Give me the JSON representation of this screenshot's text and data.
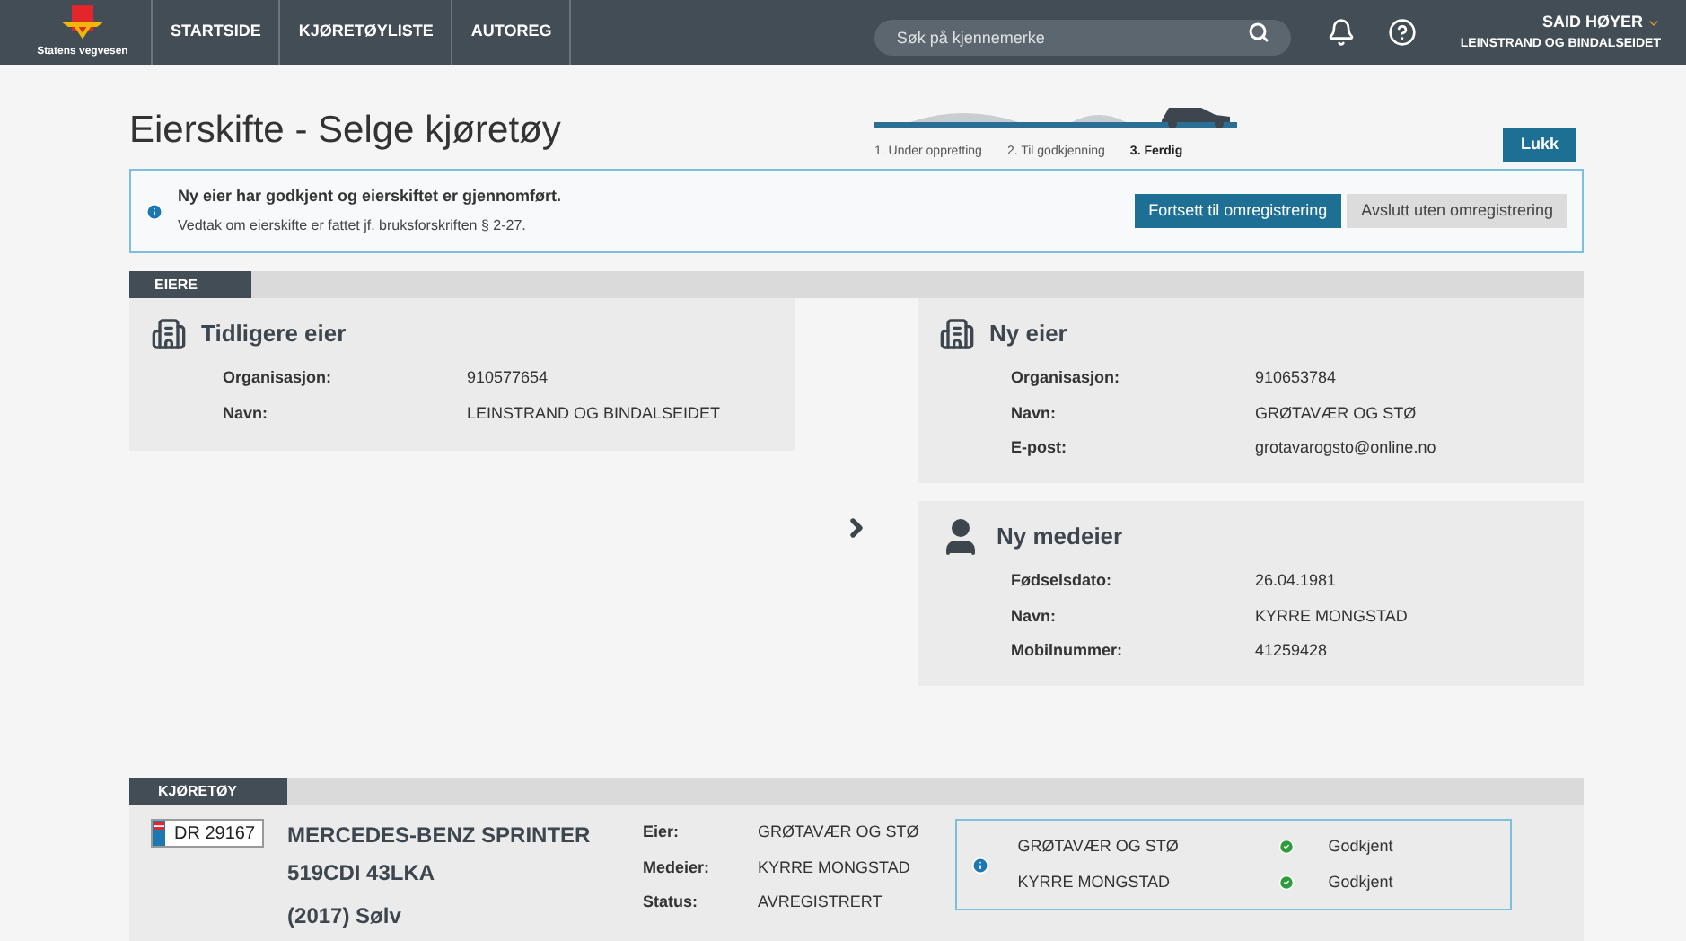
{
  "header": {
    "logo_text": "Statens vegvesen",
    "nav": [
      {
        "label": "STARTSIDE",
        "selected": false
      },
      {
        "label": "KJØRETØYLISTE",
        "selected": false
      },
      {
        "label": "AUTOREG",
        "selected": false
      }
    ],
    "search": {
      "placeholder": "Søk på kjennemerke"
    },
    "user": {
      "name": "SAID HØYER",
      "org": "LEINSTRAND OG BINDALSEIDET"
    }
  },
  "page": {
    "title": "Eierskifte - Selge kjøretøy",
    "close_button": "Lukk"
  },
  "steps": [
    {
      "label": "1. Under oppretting",
      "selected": false
    },
    {
      "label": "2. Til godkjenning",
      "selected": false
    },
    {
      "label": "3. Ferdig",
      "selected": true
    }
  ],
  "notice": {
    "title": "Ny eier har godkjent og eierskiftet er gjennomført.",
    "text": "Vedtak om eierskifte er fattet jf. bruksforskriften § 2-27.",
    "primary_button": "Fortsett til omregistrering",
    "secondary_button": "Avslutt uten omregistrering"
  },
  "owners": {
    "heading": "EIERE",
    "previous": {
      "kind": "org",
      "title": "Tidligere eier",
      "fields": [
        {
          "label": "Organisasjon:",
          "value": "910577654"
        },
        {
          "label": "Navn:",
          "value": "LEINSTRAND OG BINDALSEIDET"
        }
      ]
    },
    "new": [
      {
        "kind": "org",
        "title": "Ny eier",
        "fields": [
          {
            "label": "Organisasjon:",
            "value": "910653784"
          },
          {
            "label": "Navn:",
            "value": "GRØTAVÆR OG STØ"
          },
          {
            "label": "E-post:",
            "value": "grotavarogsto@online.no"
          }
        ]
      },
      {
        "kind": "person",
        "title": "Ny medeier",
        "fields": [
          {
            "label": "Fødselsdato:",
            "value": "26.04.1981"
          },
          {
            "label": "Navn:",
            "value": "KYRRE MONGSTAD"
          },
          {
            "label": "Mobilnummer:",
            "value": "41259428"
          }
        ]
      }
    ]
  },
  "vehicle": {
    "heading": "KJØRETØY",
    "plate": "DR 29167",
    "name_lines": [
      "MERCEDES-BENZ SPRINTER",
      "519CDI 43LKA"
    ],
    "year_color": "(2017) Sølv",
    "fields": [
      {
        "label": "Eier:",
        "value": "GRØTAVÆR OG STØ"
      },
      {
        "label": "Medeier:",
        "value": "KYRRE MONGSTAD"
      },
      {
        "label": "Status:",
        "value": "AVREGISTRERT"
      }
    ],
    "approvals": [
      {
        "name": "GRØTAVÆR OG STØ",
        "status": "Godkjent",
        "approved": true
      },
      {
        "name": "KYRRE MONGSTAD",
        "status": "Godkjent",
        "approved": true
      }
    ]
  }
}
